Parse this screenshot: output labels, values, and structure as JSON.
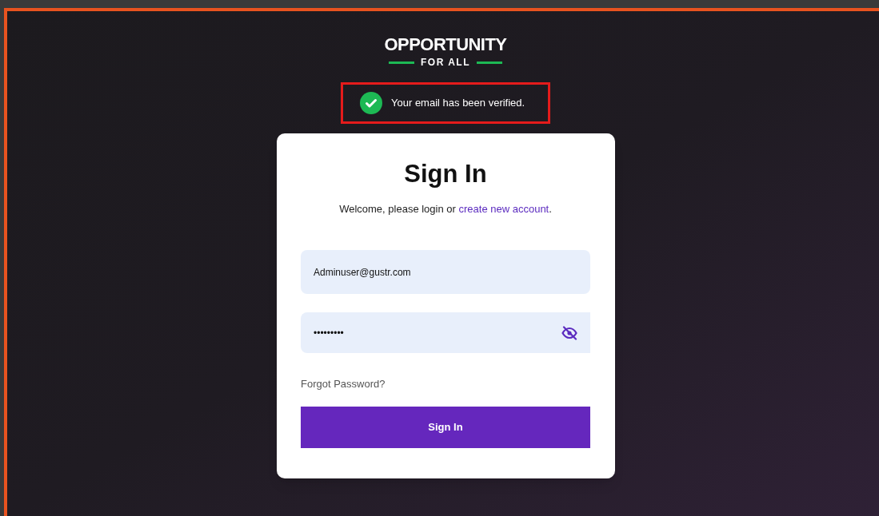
{
  "logo": {
    "title": "OPPORTUNITY",
    "subtitle": "FOR ALL"
  },
  "notice": {
    "message": "Your email has been verified.",
    "highlighted": true
  },
  "signin": {
    "title": "Sign In",
    "welcome": "Welcome, please login or ",
    "link": "create new account",
    "period": ".",
    "email": {
      "value": "Adminuser@gustr.com"
    },
    "password": {
      "value": "•••••••••"
    },
    "forgot": "Forgot Password?",
    "button": "Sign In"
  }
}
